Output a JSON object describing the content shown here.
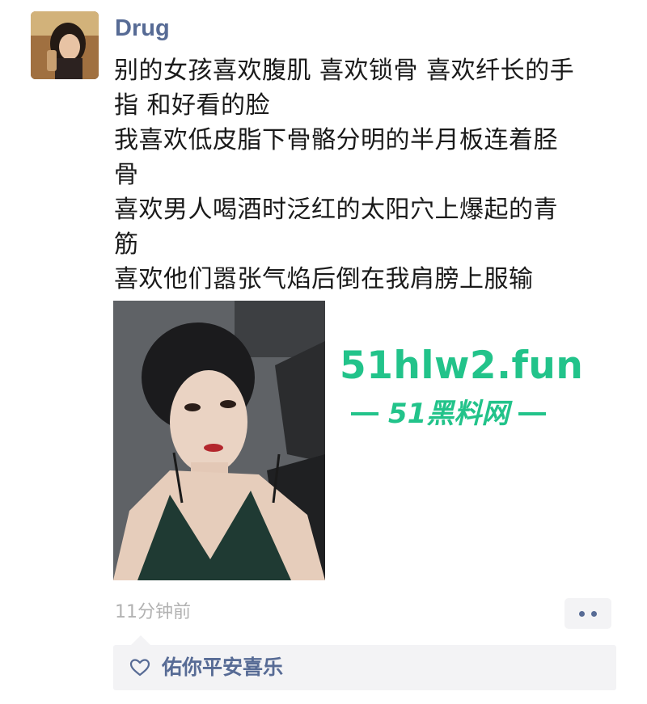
{
  "post": {
    "author": "Drug",
    "content": "别的女孩喜欢腹肌 喜欢锁骨 喜欢纤长的手\n指 和好看的脸\n我喜欢低皮脂下骨骼分明的半月板连着胫\n骨\n喜欢男人喝酒时泛红的太阳穴上爆起的青\n筋\n喜欢他们嚣张气焰后倒在我肩膀上服输",
    "timestamp": "11分钟前",
    "likes": "佑你平安喜乐"
  },
  "watermark": {
    "site": "51hlw2.fun",
    "name": "51黑料网"
  },
  "colors": {
    "link": "#576b95",
    "watermark": "#22c38a",
    "timestamp": "#b2b2b2",
    "panel": "#f3f3f5"
  },
  "icons": {
    "more": "more-dots-icon",
    "like": "heart-icon"
  }
}
